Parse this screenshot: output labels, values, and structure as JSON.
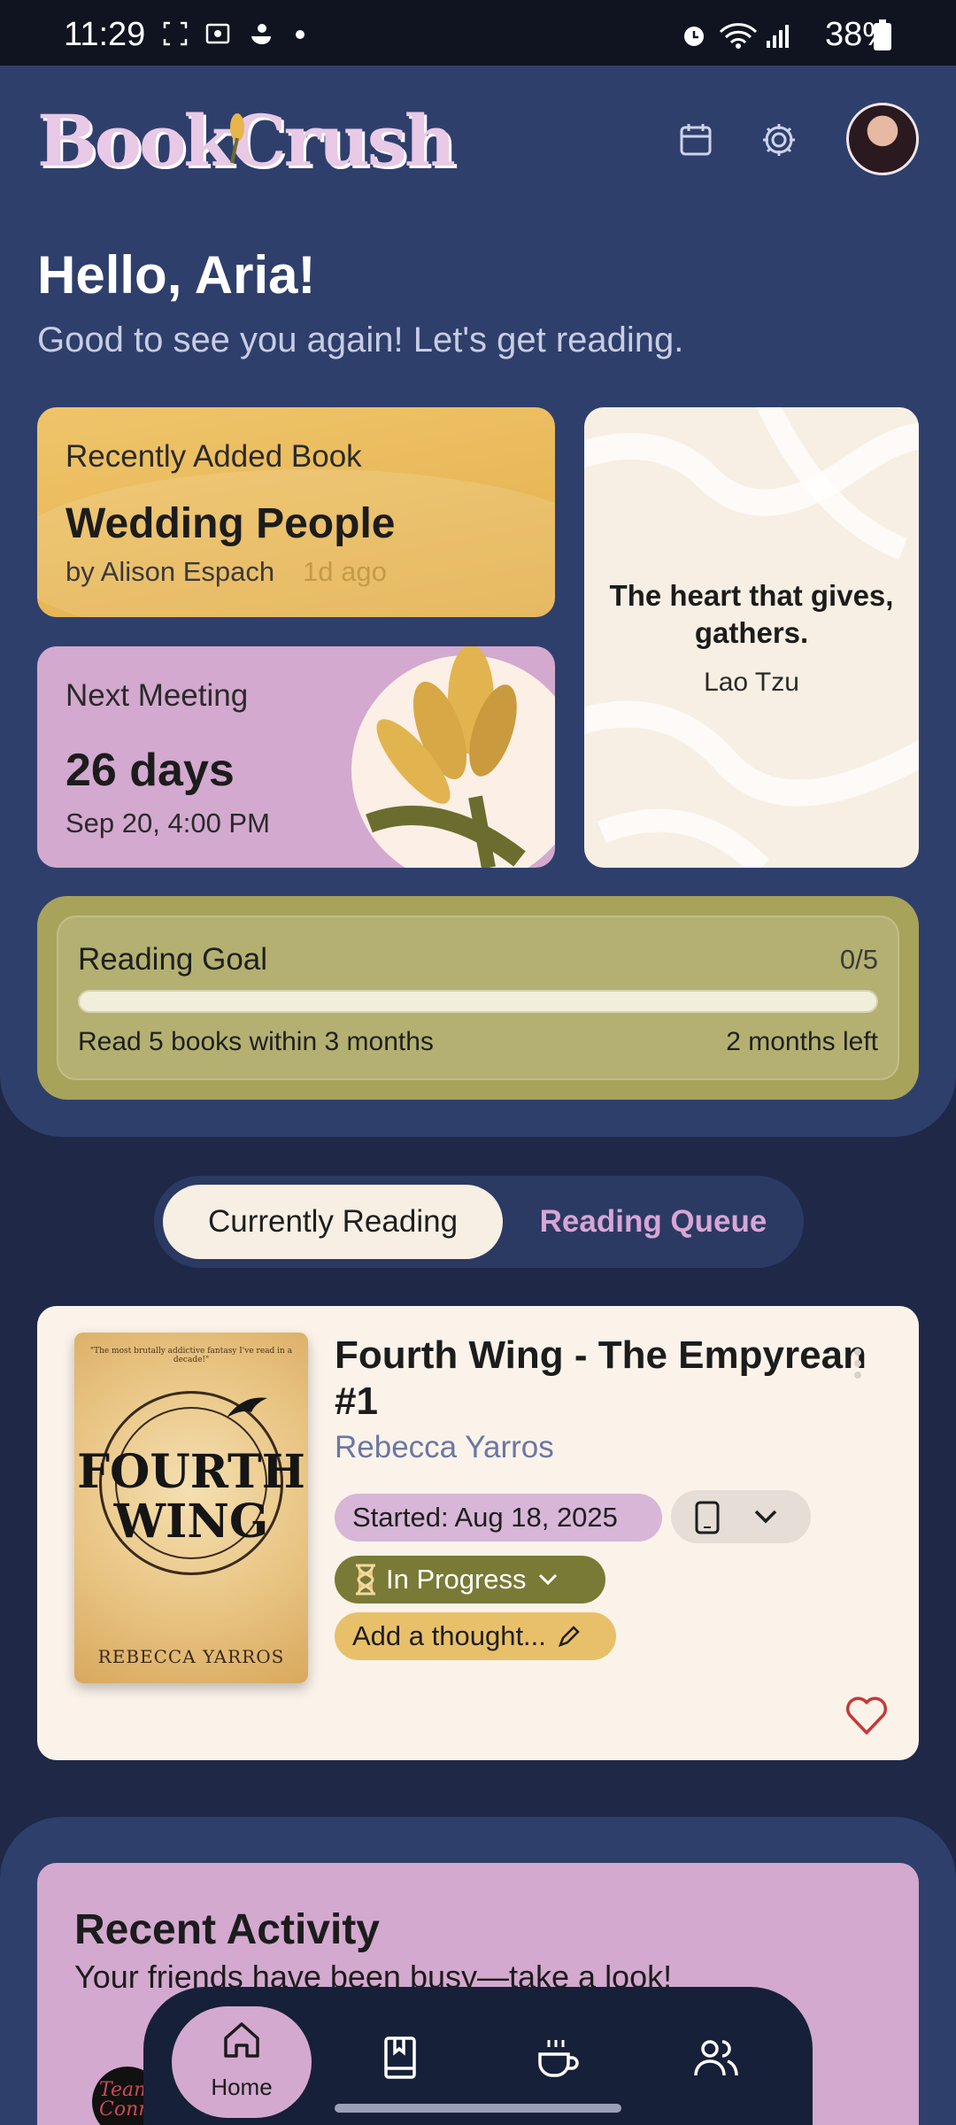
{
  "status_bar": {
    "time": "11:29",
    "battery": "38%"
  },
  "header": {
    "logo": "BookCrush"
  },
  "greeting": {
    "title": "Hello, Aria!",
    "subtitle": "Good to see you again! Let's get reading."
  },
  "recent_book": {
    "label": "Recently Added Book",
    "title": "Wedding People",
    "author": "by Alison Espach",
    "ago": "1d ago"
  },
  "next_meeting": {
    "label": "Next Meeting",
    "days": "26 days",
    "date": "Sep 20, 4:00 PM"
  },
  "quote": {
    "text": "The heart that gives, gathers.",
    "author": "Lao Tzu"
  },
  "reading_goal": {
    "title": "Reading Goal",
    "count": "0/5",
    "progress_fraction": 0,
    "description": "Read 5 books within 3 months",
    "time_left": "2 months left"
  },
  "tabs": {
    "current": "Currently Reading",
    "queue": "Reading Queue"
  },
  "current_book": {
    "cover_tagline": "\"The most brutally addictive fantasy I've read in a decade!\"",
    "cover_title_line1": "FOURTH",
    "cover_title_line2": "WING",
    "cover_author": "REBECCA YARROS",
    "title": "Fourth Wing - The Empyrean #1",
    "author": "Rebecca Yarros",
    "started": "Started: Aug 18, 2025",
    "status": "In Progress",
    "thought_placeholder": "Add a thought...",
    "format_icon": "phone-icon"
  },
  "activity": {
    "title": "Recent Activity",
    "subtitle": "Your friends have been busy—take a look!",
    "avatar_text": "Team Conrad"
  },
  "nav": {
    "home": "Home"
  }
}
